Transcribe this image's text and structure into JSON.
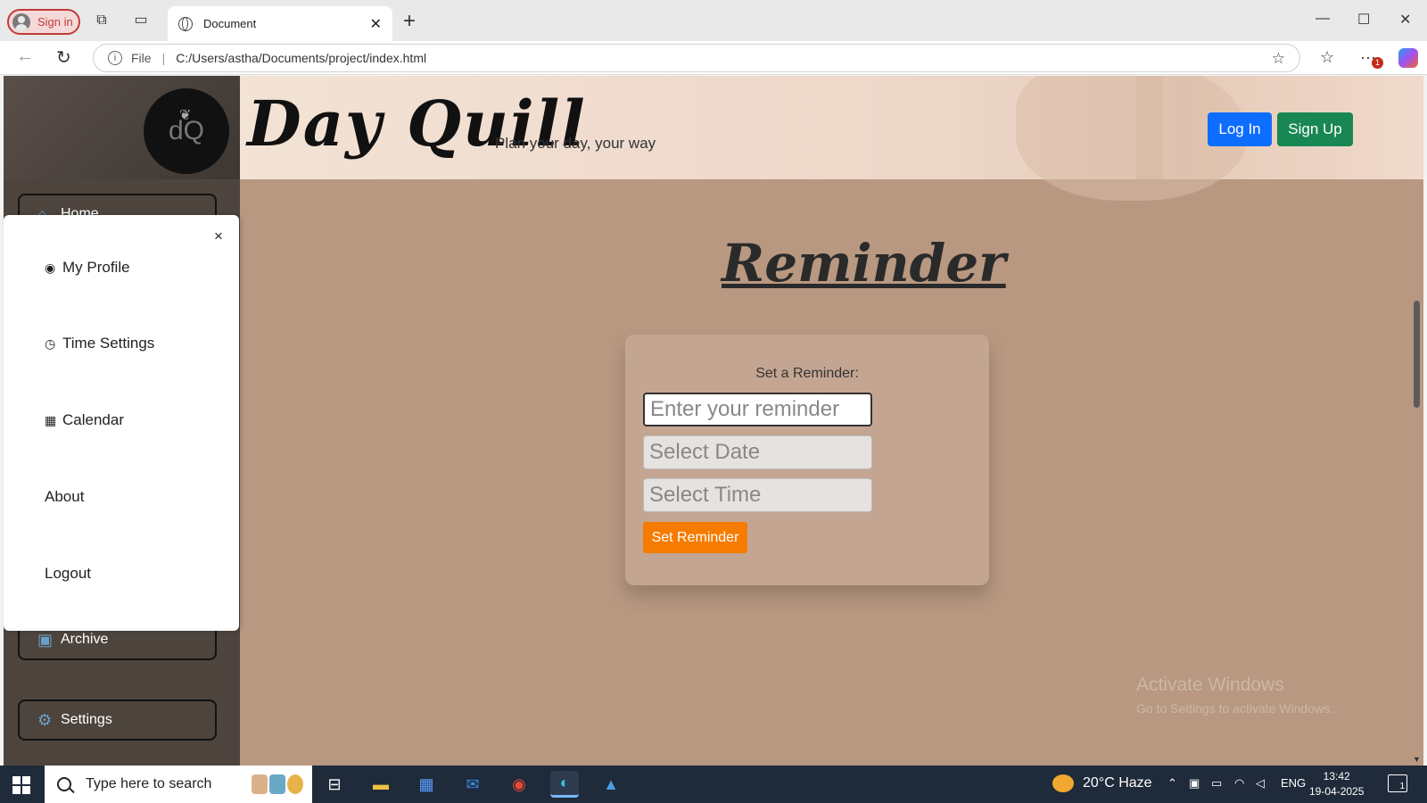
{
  "browser": {
    "signin_label": "Sign in",
    "tab_title": "Document",
    "url_scheme_label": "File",
    "url": "C:/Users/astha/Documents/project/index.html",
    "extension_badge": "1"
  },
  "sidebar": {
    "logo_text": "dQ",
    "items": [
      {
        "label": "Home"
      },
      {
        "label": "Archive"
      },
      {
        "label": "Settings"
      }
    ]
  },
  "header": {
    "brand": "Day  Quill",
    "tagline": "Plan your day, your way",
    "login_label": "Log In",
    "signup_label": "Sign Up"
  },
  "main": {
    "heading": "Reminder",
    "form": {
      "label": "Set a Reminder:",
      "reminder_placeholder": "Enter your reminder",
      "date_placeholder": "Select Date",
      "time_placeholder": "Select Time",
      "submit_label": "Set Reminder"
    }
  },
  "offcanvas": {
    "close": "×",
    "items": [
      {
        "label": "My Profile",
        "icon": "person-circle-icon"
      },
      {
        "label": "Time Settings",
        "icon": "clock-settings-icon"
      },
      {
        "label": "Calendar",
        "icon": "calendar-icon"
      },
      {
        "label": "About"
      },
      {
        "label": "Logout"
      }
    ]
  },
  "watermark": {
    "line1": "Activate Windows",
    "line2": "Go to Settings to activate Windows."
  },
  "taskbar": {
    "search_placeholder": "Type here to search",
    "weather": "20°C  Haze",
    "language": "ENG",
    "time": "13:42",
    "date": "19-04-2025",
    "notification_count": "1"
  },
  "colors": {
    "page_bg": "#b89880",
    "sidebar_bg": "#4d443e",
    "login_btn": "#0d6efd",
    "signup_btn": "#198754",
    "set_reminder_btn": "#f57c00"
  }
}
